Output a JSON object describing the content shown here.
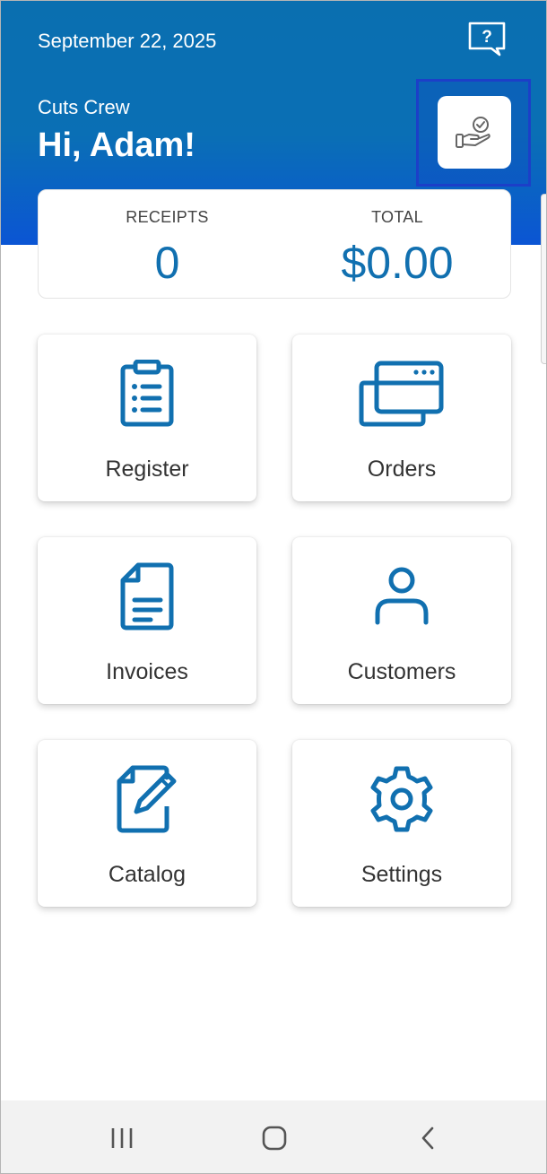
{
  "header": {
    "date": "September 22, 2025",
    "company": "Cuts Crew",
    "greeting": "Hi, Adam!",
    "help_icon": "help-question-icon",
    "action_icon": "hand-check-icon"
  },
  "summary": {
    "receipts_label": "RECEIPTS",
    "receipts_value": "0",
    "total_label": "TOTAL",
    "total_value": "$0.00"
  },
  "tiles": [
    {
      "label": "Register",
      "icon": "clipboard-list-icon"
    },
    {
      "label": "Orders",
      "icon": "credit-cards-icon"
    },
    {
      "label": "Invoices",
      "icon": "document-icon"
    },
    {
      "label": "Customers",
      "icon": "person-icon"
    },
    {
      "label": "Catalog",
      "icon": "edit-document-icon"
    },
    {
      "label": "Settings",
      "icon": "gear-icon"
    }
  ],
  "nav": {
    "recents_icon": "recents-icon",
    "home_icon": "home-icon",
    "back_icon": "back-icon"
  },
  "colors": {
    "primary": "#0a6fb0",
    "accent": "#1170b0",
    "header_bottom": "#0b55d4"
  }
}
